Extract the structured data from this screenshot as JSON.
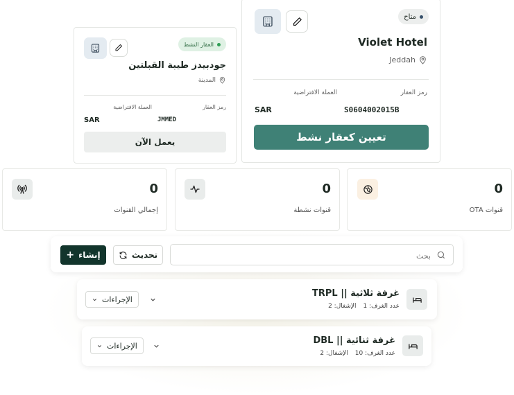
{
  "hotel_card": {
    "status_badge": "متاح",
    "name": "Violet Hotel",
    "city": "Jeddah",
    "property_code_label": "رمز العقار",
    "property_code": "S0604002015B",
    "currency_label": "العملة الافتراضية",
    "currency": "SAR",
    "action_button": "تعيين كعقار نشط"
  },
  "active_card": {
    "status_badge": "العقار النشط",
    "name": "جودبيدز طيبة القبلتين",
    "city": "المدينة",
    "property_code_label": "رمز العقار",
    "property_code": "JMMED",
    "currency_label": "العملة الافتراضية",
    "currency": "SAR",
    "status_button": "يعمل الآن"
  },
  "stats": [
    {
      "value": "0",
      "label": "قنوات OTA",
      "icon": "globe-icon"
    },
    {
      "value": "0",
      "label": "قنوات نشطة",
      "icon": "activity-icon"
    },
    {
      "value": "0",
      "label": "إجمالي القنوات",
      "icon": "broadcast-icon"
    }
  ],
  "toolbar": {
    "search_placeholder": "بحث",
    "refresh_label": "تحديث",
    "create_label": "إنشاء"
  },
  "rooms": [
    {
      "title": "غرفة ثلاثية || TRPL",
      "rooms_label": "عدد الغرف:",
      "rooms_count": "1",
      "occupancy_label": "الإشغال:",
      "occupancy": "2",
      "actions_label": "الإجراءات"
    },
    {
      "title": "غرفة ثنائية || DBL",
      "rooms_label": "عدد الغرف:",
      "rooms_count": "10",
      "occupancy_label": "الإشغال:",
      "occupancy": "2",
      "actions_label": "الإجراءات"
    }
  ],
  "colors": {
    "primary": "#3f8176",
    "dark": "#12352c",
    "badge_green_bg": "#dff1e4",
    "badge_gray_bg": "#eceeed"
  }
}
